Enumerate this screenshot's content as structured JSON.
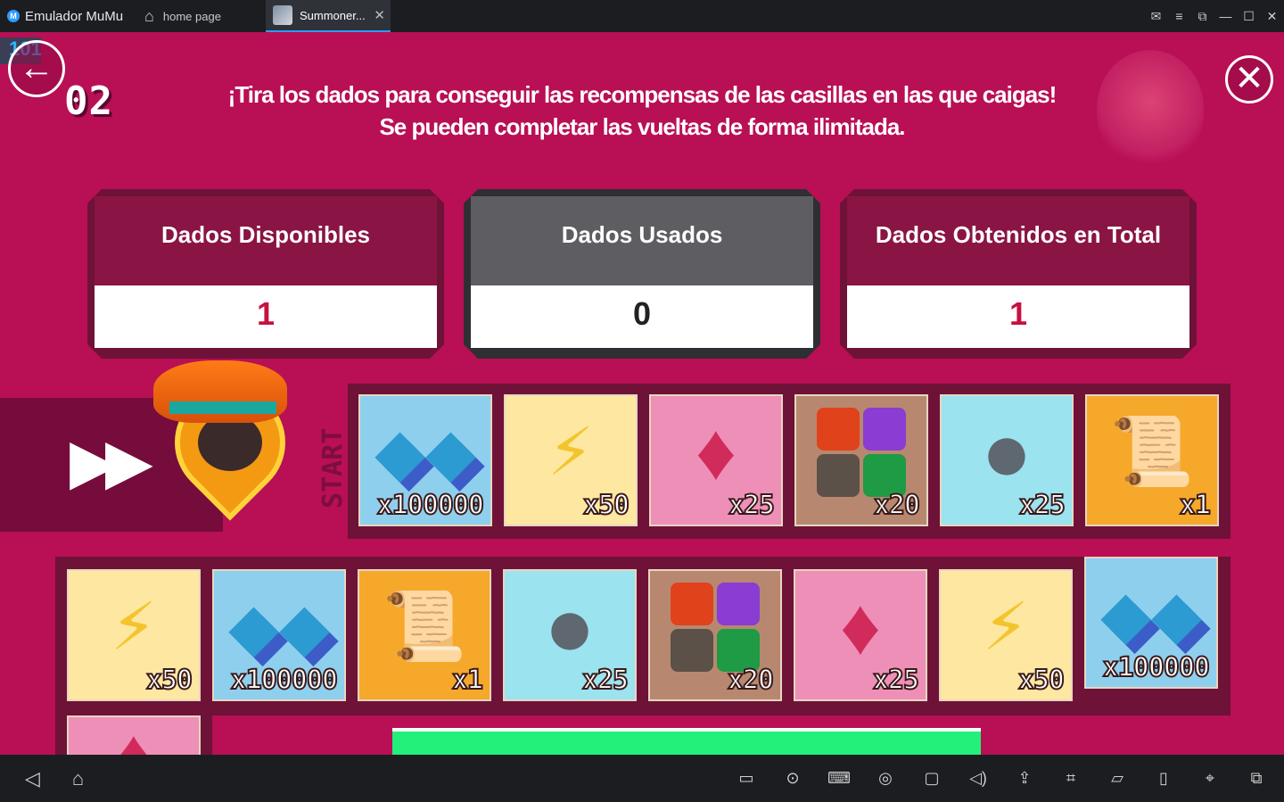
{
  "titlebar": {
    "app_name": "Emulador MuMu",
    "home_tab": "home page",
    "game_tab": "Summoner...",
    "close_tab_icon": "close-icon"
  },
  "game": {
    "corner_tag": "101",
    "stage": "02",
    "instruction_line1": "¡Tira los dados para conseguir las recompensas de las casillas en las que caigas!",
    "instruction_line2": "Se pueden completar las vueltas de forma ilimitada.",
    "start_label": "START",
    "panels": [
      {
        "label": "Dados Disponibles",
        "value": "1"
      },
      {
        "label": "Dados Usados",
        "value": "0"
      },
      {
        "label": "Dados Obtenidos en Total",
        "value": "1"
      }
    ],
    "row1": [
      {
        "item": "crystals",
        "qty": "x100000"
      },
      {
        "item": "energy",
        "qty": "x50"
      },
      {
        "item": "gem",
        "qty": "x25"
      },
      {
        "item": "runes",
        "qty": "x20"
      },
      {
        "item": "stone",
        "qty": "x25"
      },
      {
        "item": "scroll",
        "qty": "x1"
      }
    ],
    "row2": [
      {
        "item": "energy",
        "qty": "x50"
      },
      {
        "item": "crystals",
        "qty": "x100000"
      },
      {
        "item": "scroll",
        "qty": "x1"
      },
      {
        "item": "stone",
        "qty": "x25"
      },
      {
        "item": "runes",
        "qty": "x20"
      },
      {
        "item": "gem",
        "qty": "x25"
      },
      {
        "item": "energy",
        "qty": "x50"
      },
      {
        "item": "crystals",
        "qty": "x100000"
      }
    ]
  },
  "colors": {
    "background": "#b80f55",
    "panel_value_red": "#c8103f",
    "progress_green": "#23f07a"
  }
}
